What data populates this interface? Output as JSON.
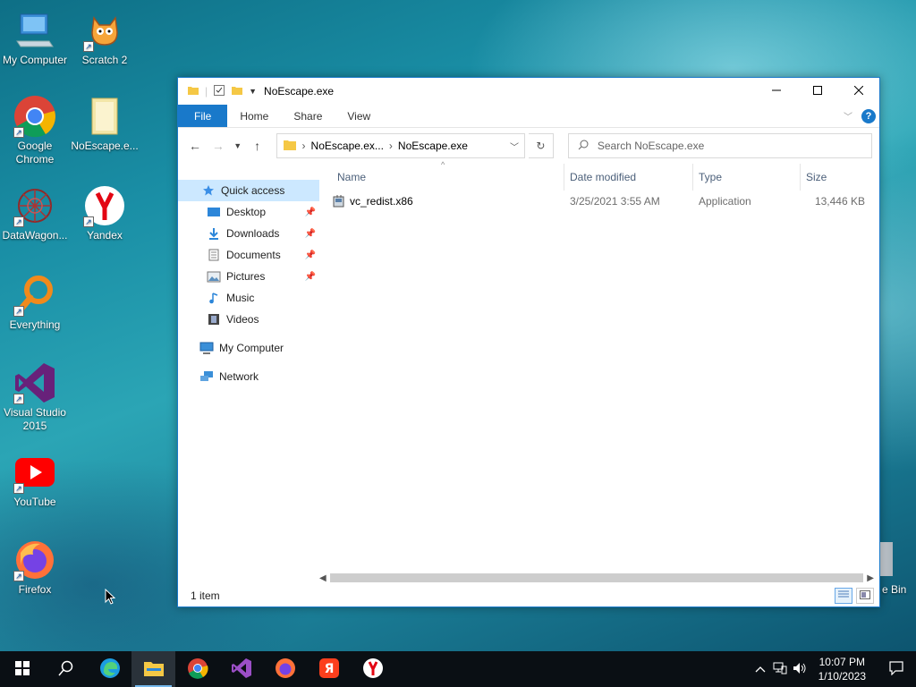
{
  "desktop": {
    "icons": [
      {
        "label": "My Computer",
        "icon": "computer-icon"
      },
      {
        "label": "Scratch 2",
        "icon": "scratch-cat-icon"
      },
      {
        "label": "Google Chrome",
        "icon": "chrome-icon"
      },
      {
        "label": "NoEscape.e...",
        "icon": "folder-icon"
      },
      {
        "label": "DataWagon...",
        "icon": "datawagon-icon"
      },
      {
        "label": "Yandex",
        "icon": "yandex-icon"
      },
      {
        "label": "Everything",
        "icon": "everything-search-icon"
      },
      {
        "label": "Visual Studio 2015",
        "icon": "visual-studio-icon"
      },
      {
        "label": "YouTube",
        "icon": "youtube-icon"
      },
      {
        "label": "Firefox",
        "icon": "firefox-icon"
      }
    ],
    "recycle_bin_label": "e Bin"
  },
  "window": {
    "title": "NoEscape.exe",
    "ribbon_tabs": [
      "File",
      "Home",
      "Share",
      "View"
    ],
    "breadcrumb": [
      "NoEscape.ex...",
      "NoEscape.exe"
    ],
    "search_placeholder": "Search NoEscape.exe",
    "nav_pane": [
      {
        "label": "Quick access",
        "icon": "star-icon",
        "selected": true
      },
      {
        "label": "Desktop",
        "icon": "desktop-folder-icon",
        "pinned": true
      },
      {
        "label": "Downloads",
        "icon": "download-arrow-icon",
        "pinned": true
      },
      {
        "label": "Documents",
        "icon": "documents-icon",
        "pinned": true
      },
      {
        "label": "Pictures",
        "icon": "pictures-icon",
        "pinned": true
      },
      {
        "label": "Music",
        "icon": "music-note-icon"
      },
      {
        "label": "Videos",
        "icon": "film-icon"
      },
      {
        "label": "My Computer",
        "icon": "computer-icon"
      },
      {
        "label": "Network",
        "icon": "network-icon"
      }
    ],
    "columns": [
      "Name",
      "Date modified",
      "Type",
      "Size"
    ],
    "files": [
      {
        "name": "vc_redist.x86",
        "date_modified": "3/25/2021 3:55 AM",
        "type": "Application",
        "size": "13,446 KB"
      }
    ],
    "status": "1 item"
  },
  "taskbar": {
    "apps": [
      "start-icon",
      "search-icon",
      "edge-icon",
      "file-explorer-icon",
      "chrome-icon",
      "visual-studio-icon",
      "firefox-icon",
      "yandex-browser-icon",
      "yandex-icon"
    ],
    "clock_time": "10:07 PM",
    "clock_date": "1/10/2023"
  },
  "colors": {
    "accent": "#1979ca",
    "selection": "#cce8ff",
    "taskbar": "#0a0f14"
  }
}
